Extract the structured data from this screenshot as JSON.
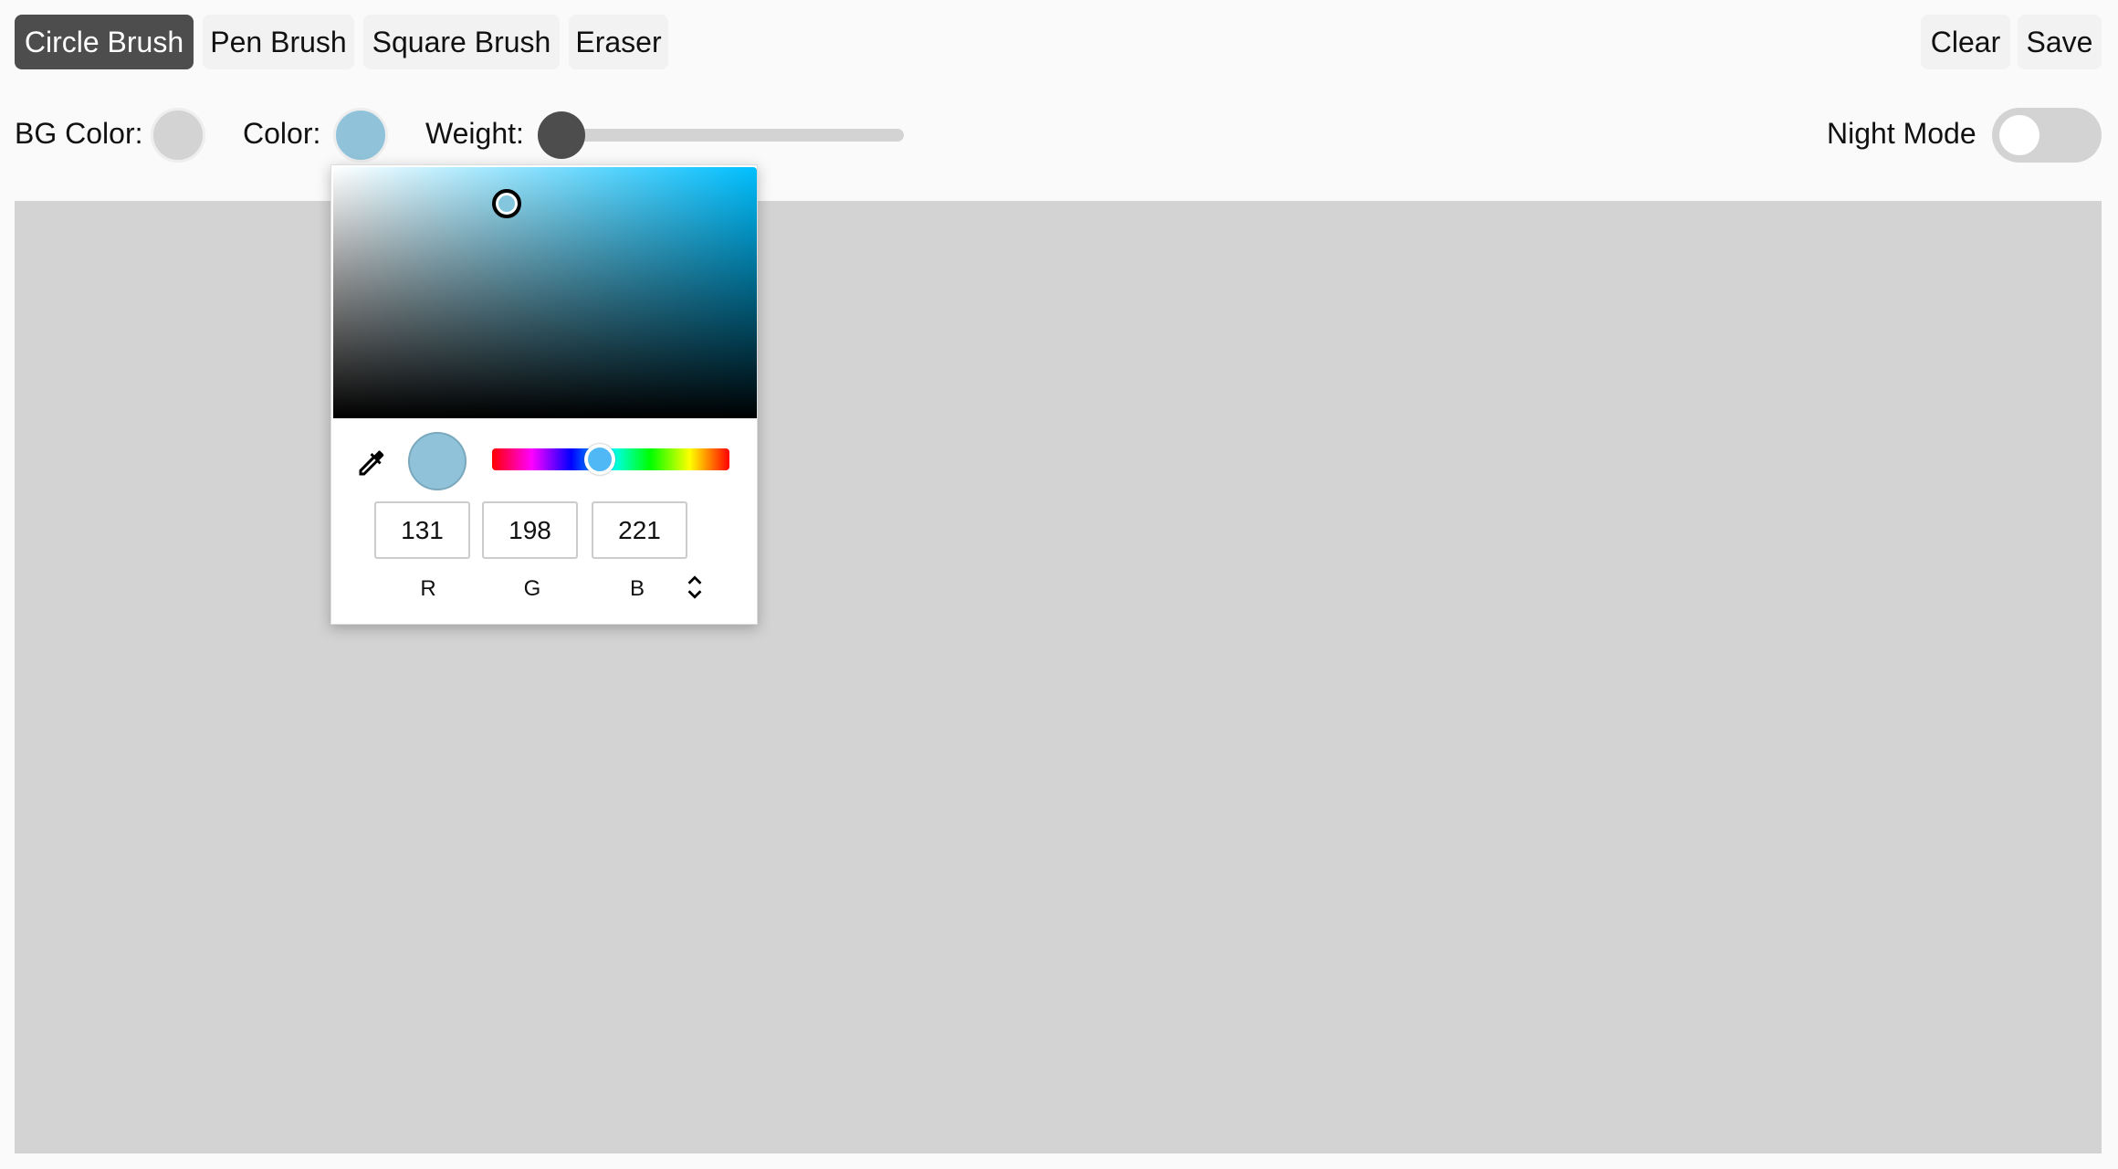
{
  "toolbar": {
    "brushes": [
      "Circle Brush",
      "Pen Brush",
      "Square Brush",
      "Eraser"
    ],
    "active": "Circle Brush",
    "clear": "Clear",
    "save": "Save"
  },
  "controls": {
    "bg_color_label": "BG Color:",
    "bg_color": "#d3d3d3",
    "color_label": "Color:",
    "color": "#83c6dd",
    "weight_label": "Weight:",
    "weight_value": 0,
    "night_mode_label": "Night Mode",
    "night_mode": false
  },
  "picker": {
    "r": "131",
    "g": "198",
    "b": "221",
    "r_label": "R",
    "g_label": "G",
    "b_label": "B",
    "hue_deg": 195,
    "mode_toggle_icon": "up-down-chevron-icon",
    "eyedropper_icon": "eyedropper-icon"
  },
  "canvas": {
    "background": "#d3d3d3"
  }
}
